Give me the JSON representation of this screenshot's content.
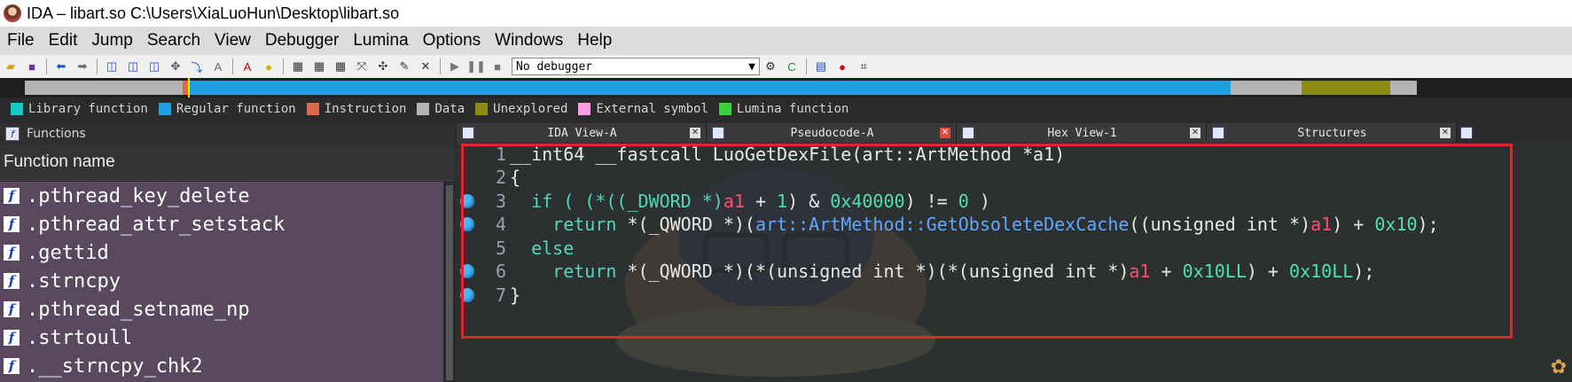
{
  "window": {
    "title": "IDA – libart.so C:\\Users\\XiaLuoHun\\Desktop\\libart.so"
  },
  "menu": [
    "File",
    "Edit",
    "Jump",
    "Search",
    "View",
    "Debugger",
    "Lumina",
    "Options",
    "Windows",
    "Help"
  ],
  "toolbar": {
    "debugger_value": "No debugger"
  },
  "legend": [
    {
      "label": "Library function",
      "color": "#14c8c8"
    },
    {
      "label": "Regular function",
      "color": "#1ba1e2"
    },
    {
      "label": "Instruction",
      "color": "#d96b4a"
    },
    {
      "label": "Data",
      "color": "#b4b4b4"
    },
    {
      "label": "Unexplored",
      "color": "#8c8c14"
    },
    {
      "label": "External symbol",
      "color": "#ff9ce6"
    },
    {
      "label": "Lumina function",
      "color": "#3cd23c"
    }
  ],
  "functions": {
    "panel_title": "Functions",
    "column_header": "Function name",
    "items": [
      ".pthread_key_delete",
      ".pthread_attr_setstack",
      ".gettid",
      ".strncpy",
      ".pthread_setname_np",
      ".strtoull",
      ".__strncpy_chk2"
    ]
  },
  "tabs": [
    {
      "label": "IDA View-A",
      "active": false
    },
    {
      "label": "Pseudocode-A",
      "active": true
    },
    {
      "label": "Hex View-1",
      "active": false
    },
    {
      "label": "Structures",
      "active": false
    }
  ],
  "code": {
    "lines": [
      {
        "no": "1",
        "bp": false
      },
      {
        "no": "2",
        "bp": false
      },
      {
        "no": "3",
        "bp": true
      },
      {
        "no": "4",
        "bp": true
      },
      {
        "no": "5",
        "bp": false
      },
      {
        "no": "6",
        "bp": true
      },
      {
        "no": "7",
        "bp": true
      }
    ],
    "l1": {
      "ret": "__int64 __fastcall ",
      "name": "LuoGetDexFile",
      "args": "(art::ArtMethod *a1)"
    },
    "l2": "{",
    "l3": {
      "a": "  if ( (*((_DWORD *)",
      "v": "a1",
      "b": " + ",
      "n1": "1",
      "c": ") & ",
      "n2": "0x40000",
      "d": ") != ",
      "n3": "0",
      "e": " )"
    },
    "l4": {
      "kw": "    return",
      "a": " *(_QWORD *)(",
      "fn": "art::ArtMethod::GetObsoleteDexCache",
      "b": "((unsigned int *)",
      "v": "a1",
      "c": ") + ",
      "n": "0x10",
      "d": ");"
    },
    "l5": "  else",
    "l6": {
      "kw": "    return",
      "a": " *(_QWORD *)(*(unsigned int *)(*(unsigned int *)",
      "v": "a1",
      "b": " + ",
      "n1": "0x10LL",
      "c": ") + ",
      "n2": "0x10LL",
      "d": ");"
    },
    "l7": "}"
  }
}
